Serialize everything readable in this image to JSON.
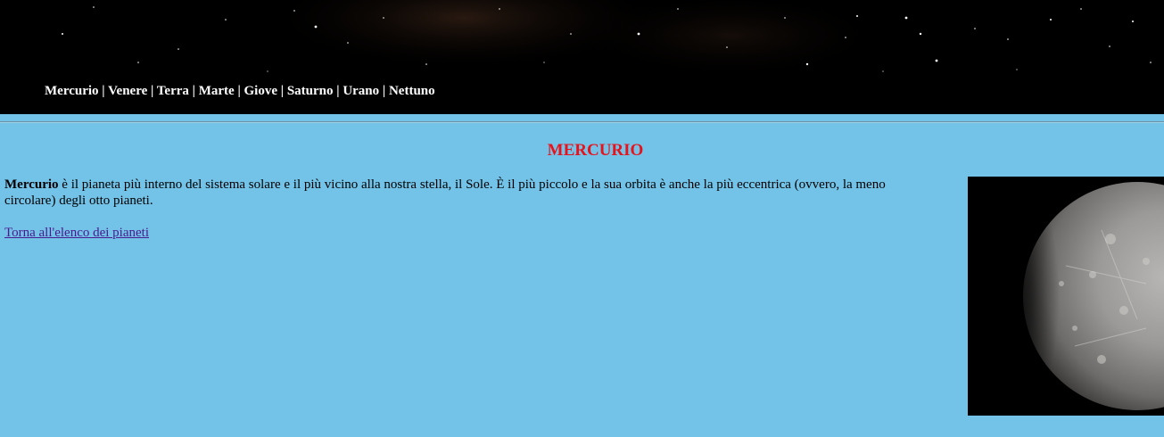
{
  "nav": {
    "items": [
      {
        "label": "Mercurio"
      },
      {
        "label": "Venere"
      },
      {
        "label": "Terra"
      },
      {
        "label": "Marte"
      },
      {
        "label": "Giove"
      },
      {
        "label": "Saturno"
      },
      {
        "label": "Urano"
      },
      {
        "label": "Nettuno"
      }
    ],
    "separator": " | "
  },
  "main": {
    "title": "MERCURIO",
    "intro_bold": "Mercurio",
    "intro_text": " è il pianeta più interno del sistema solare e il più vicino alla nostra stella, il Sole. È il più piccolo e la sua orbita è anche la più eccentrica (ovvero, la meno circolare) degli otto pianeti.",
    "back_link": "Torna all'elenco dei pianeti"
  },
  "image": {
    "name": "mercury-image"
  },
  "colors": {
    "background": "#73c2e7",
    "title": "#e8121b",
    "link": "#4a1a8e",
    "header": "#000000"
  }
}
